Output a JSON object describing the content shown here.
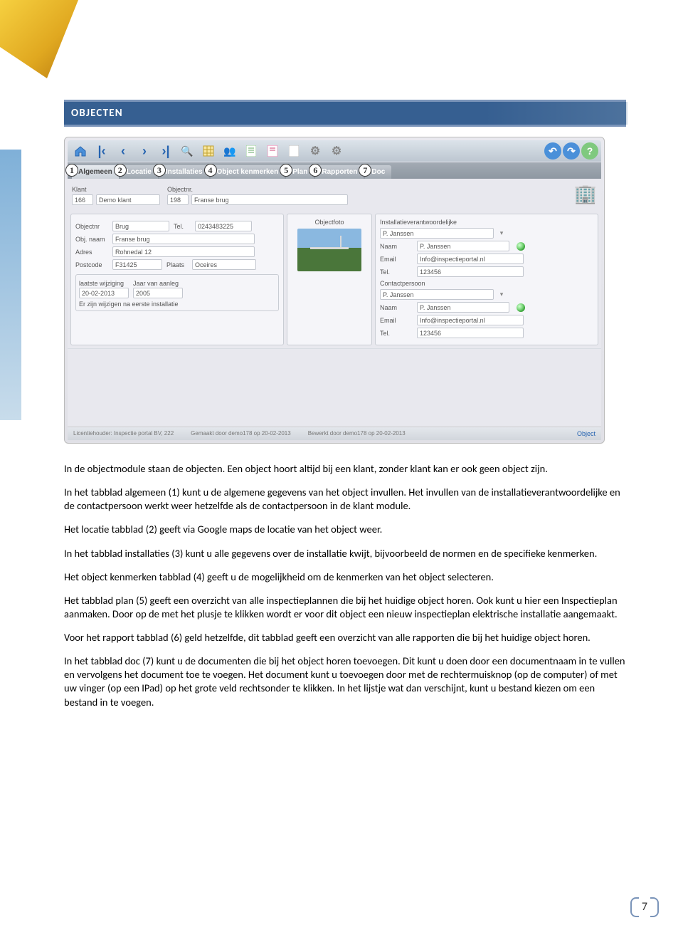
{
  "section": {
    "title": "OBJECTEN"
  },
  "tabs": [
    {
      "n": "1",
      "label": "Algemeen"
    },
    {
      "n": "2",
      "label": "Locatie"
    },
    {
      "n": "3",
      "label": "Installaties"
    },
    {
      "n": "4",
      "label": "Object kenmerken"
    },
    {
      "n": "5",
      "label": "Plan"
    },
    {
      "n": "6",
      "label": "Rapporten"
    },
    {
      "n": "7",
      "label": "Doc"
    }
  ],
  "header": {
    "klant_label": "Klant",
    "klant_nr": "166",
    "klant_naam": "Demo klant",
    "objectnr_label": "Objectnr.",
    "objectnr": "198",
    "object_naam": "Franse brug"
  },
  "left": {
    "objectnr_label": "Objectnr",
    "objectnr": "Brug",
    "tel_label": "Tel.",
    "tel": "0243483225",
    "objnaam_label": "Obj. naam",
    "objnaam": "Franse brug",
    "adres_label": "Adres",
    "adres": "Rohnedal 12",
    "postcode_label": "Postcode",
    "postcode": "F31425",
    "plaats_label": "Plaats",
    "plaats": "Oceires",
    "lw_label": "laatste wijziging",
    "lw": "20-02-2013",
    "ja_label": "Jaar van aanleg",
    "ja": "2005",
    "note": "Er zijn wijzigen na eerste installatie"
  },
  "mid": {
    "title": "Objectfoto"
  },
  "right": {
    "iv_label": "Installatieverantwoordelijke",
    "iv": "P. Janssen",
    "naam_label": "Naam",
    "naam": "P. Janssen",
    "email_label": "Email",
    "email": "Info@inspectieportal.nl",
    "tel_label": "Tel.",
    "tel": "123456",
    "cp_label": "Contactpersoon",
    "cp": "P. Janssen",
    "naam2": "P. Janssen",
    "email2": "Info@inspectieportal.nl",
    "tel2": "123456"
  },
  "footer": {
    "lic": "Licentiehouder: Inspectie portal BV, 222",
    "made": "Gemaakt door demo178 op 20-02-2013",
    "edit": "Bewerkt door demo178 op 20-02-2013",
    "obj": "Object"
  },
  "paras": {
    "p1": "In de objectmodule staan de objecten. Een object hoort altijd bij een klant, zonder klant kan er ook geen object zijn.",
    "p2": "In het tabblad algemeen (1) kunt u de algemene gegevens van het object invullen. Het invullen van de installatieverantwoordelijke en de contactpersoon werkt weer hetzelfde als de contactpersoon in de klant module.",
    "p3": "Het locatie tabblad (2) geeft via Google maps de locatie van het object weer.",
    "p4": "In het tabblad installaties (3) kunt u alle gegevens over de installatie kwijt, bijvoorbeeld de normen en de specifieke kenmerken.",
    "p5": "Het object kenmerken tabblad (4) geeft u de mogelijkheid om de kenmerken van het object selecteren.",
    "p6": "Het tabblad plan (5) geeft een overzicht van alle inspectieplannen die bij het huidige object horen. Ook kunt u hier een Inspectieplan aanmaken. Door op de met het plusje te klikken wordt er voor dit object een nieuw inspectieplan elektrische installatie aangemaakt.",
    "p7": "Voor het rapport tabblad (6) geld hetzelfde, dit tabblad geeft een overzicht van alle rapporten die bij het huidige object horen.",
    "p8": "In het tabblad doc (7) kunt u de documenten die bij het object horen toevoegen. Dit kunt u doen door een documentnaam in te vullen en vervolgens het document toe te voegen. Het document kunt u toevoegen door met de rechtermuisknop (op de computer) of met uw vinger (op een IPad) op het grote veld rechtsonder te klikken. In het lijstje wat dan verschijnt, kunt u bestand kiezen om een bestand in te voegen."
  },
  "page": "7"
}
